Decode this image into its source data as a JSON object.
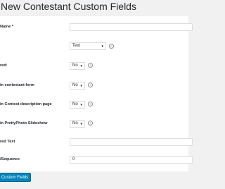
{
  "page_title": "New Contestant Custom Fields",
  "fields": {
    "name_label": "Name *",
    "type_value": "Text",
    "required_label": "red:",
    "required_value": "No",
    "show_contestant_form_label": "in contestant form",
    "show_contestant_form_value": "No",
    "show_contest_description_label": "in Contest description page",
    "show_contest_description_value": "No",
    "show_prettyphoto_label": "in PrettyPhoto Slideshow",
    "show_prettyphoto_value": "No",
    "required_text_label": "red Text",
    "sequence_label": "/Sequence",
    "sequence_value": "0"
  },
  "help_glyph": "?",
  "dropdown_arrow": "▼",
  "save_button_label": "Custom Fields"
}
